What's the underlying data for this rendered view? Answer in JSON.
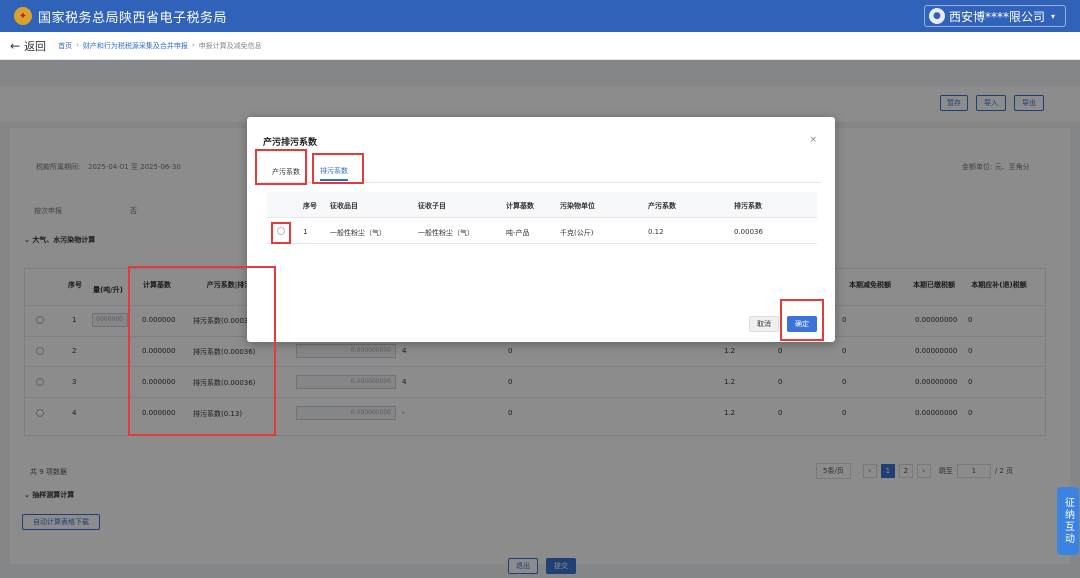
{
  "header": {
    "site_title": "国家税务总局陕西省电子税务局",
    "user_name": "西安博****限公司",
    "user_chevron": "▾"
  },
  "breadcrumb": {
    "back_label": "返回",
    "items": [
      "首页",
      "财产和行为税税源采集及合并申报",
      "申报计算及减免信息"
    ],
    "separator": "›"
  },
  "toolbar": {
    "save_label": "暂存",
    "import_label": "导入",
    "export_label": "导出"
  },
  "info": {
    "period_label": "税款所属期间:",
    "period_value": "2025-04-01 至 2025-06-30",
    "unit_label": "金额单位: 元、至角分",
    "by_period_label": "按次申报",
    "by_period_value": "否"
  },
  "section_air": {
    "title": "大气、水污染物计算"
  },
  "bg_table": {
    "headers": [
      "序号",
      "量(吨/升)",
      "计算基数",
      "产污系数|排污",
      "本期减免税额",
      "本期已缴税额",
      "本期应补(退)税额"
    ],
    "rows": [
      {
        "no": "1",
        "base": "0.000000",
        "coef": "排污系数(0.0003",
        "qty": "0000000",
        "reduce": "0",
        "paid": "0.00000000",
        "due": "0"
      },
      {
        "no": "2",
        "base": "0.000000",
        "coef": "排污系数(0.00036)",
        "val": "0.000000000",
        "n4": "4",
        "zero": "0",
        "rate": "1.2",
        "z2": "0",
        "reduce": "0",
        "paid": "0.00000000",
        "due": "0"
      },
      {
        "no": "3",
        "base": "0.000000",
        "coef": "排污系数(0.00036)",
        "val": "0.000000000",
        "n4": "4",
        "zero": "0",
        "rate": "1.2",
        "z2": "0",
        "reduce": "0",
        "paid": "0.00000000",
        "due": "0"
      },
      {
        "no": "4",
        "base": "0.000000",
        "coef": "排污系数(0.13)",
        "val": "0.000000000",
        "n4": "-",
        "zero": "0",
        "rate": "1.2",
        "z2": "0",
        "reduce": "0",
        "paid": "0.00000000",
        "due": "0"
      }
    ]
  },
  "pagination": {
    "total": "共 9 项数据",
    "page_size": "5条/页",
    "prev": "‹",
    "pages": [
      "1",
      "2"
    ],
    "next": "›",
    "goto_label": "跳至",
    "goto_value": "1",
    "total_pages": "/ 2 页"
  },
  "section_sample": {
    "title": "抽样测算计算",
    "download_label": "自动计算表格下载"
  },
  "footer": {
    "exit_label": "退出",
    "submit_label": "提交"
  },
  "modal": {
    "title": "产污排污系数",
    "close": "×",
    "tabs": [
      "产污系数",
      "排污系数"
    ],
    "active_tab": 1,
    "columns": [
      "序号",
      "征收品目",
      "征收子目",
      "计算基数",
      "污染物单位",
      "产污系数",
      "排污系数"
    ],
    "rows": [
      {
        "no": "1",
        "item": "一般性粉尘（气）",
        "subitem": "一般性粉尘（气）",
        "base": "吨-产品",
        "unit": "千克(公斤)",
        "produce": "0.12",
        "emit": "0.00036"
      }
    ],
    "cancel_label": "取消",
    "ok_label": "确定"
  },
  "side_float": {
    "label": "征纳互动"
  },
  "colors": {
    "brand": "#2f62b8",
    "primary": "#3b73d6",
    "annotation": "#e23b3b"
  }
}
